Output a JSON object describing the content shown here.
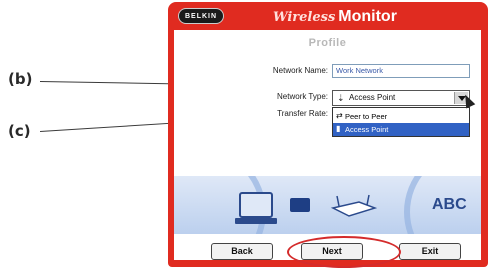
{
  "callouts": {
    "b": "(b)",
    "c": "(c)"
  },
  "window": {
    "logo": "BELKIN",
    "title_prefix": "Wireless",
    "title_main": "Monitor",
    "heading": "Profile"
  },
  "form": {
    "network_name_label": "Network Name:",
    "network_name_value": "Work Network",
    "network_type_label": "Network Type:",
    "network_type_value": "Access Point",
    "transfer_rate_label": "Transfer Rate:",
    "options": [
      "Peer to Peer",
      "Access Point"
    ],
    "selected_option": "Access Point"
  },
  "illustration": {
    "text": "ABC"
  },
  "buttons": {
    "back": "Back",
    "next": "Next",
    "exit": "Exit"
  },
  "colors": {
    "window_frame": "#e02b20",
    "selection": "#3162c4",
    "highlight_ring": "#d42b2b"
  }
}
